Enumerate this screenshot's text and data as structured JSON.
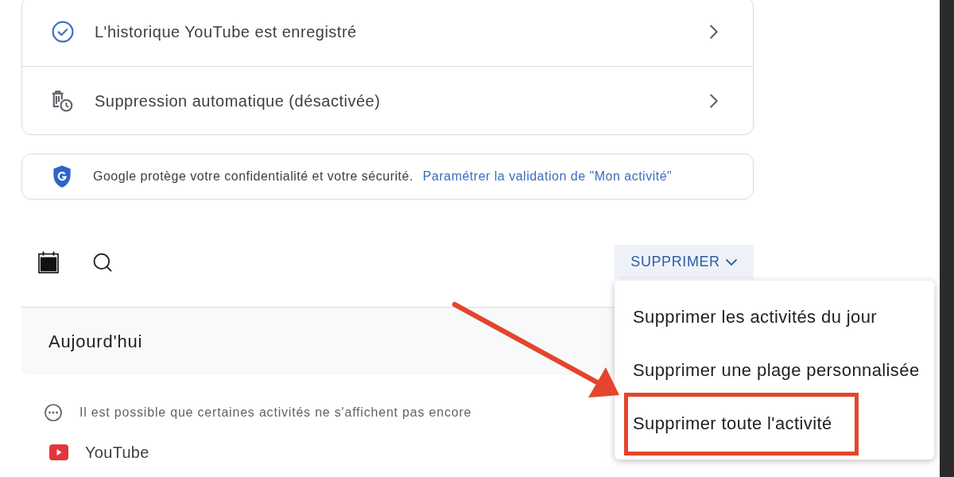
{
  "settings_card": {
    "rows": [
      {
        "kind": "history",
        "label": "L'historique YouTube est enregistré"
      },
      {
        "kind": "auto_delete",
        "label": "Suppression automatique (désactivée)"
      }
    ]
  },
  "security_notice": {
    "text": "Google protège votre confidentialité et votre sécurité.",
    "link": "Paramétrer la validation de \"Mon activité\""
  },
  "toolbar": {
    "delete_button": {
      "label": "SUPPRIMER",
      "expanded": true
    }
  },
  "delete_menu": {
    "items": [
      {
        "label": "Supprimer les activités du jour",
        "annotated": false
      },
      {
        "label": "Supprimer une plage personnalisée",
        "annotated": false
      },
      {
        "label": "Supprimer toute l'activité",
        "annotated": true
      }
    ]
  },
  "day_group": {
    "title": "Aujourd'hui",
    "notice": "Il est possible que certaines activités ne s'affichent pas encore",
    "entries": [
      {
        "kind": "youtube",
        "label": "YouTube"
      }
    ]
  }
}
